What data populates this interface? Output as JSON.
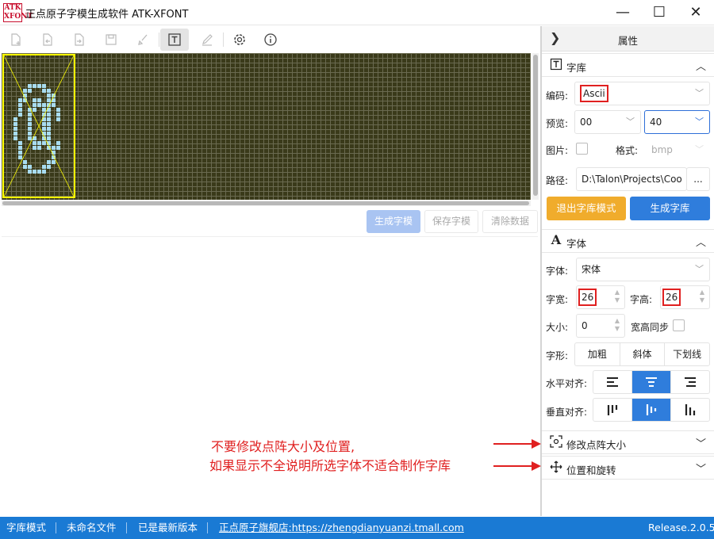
{
  "window": {
    "title": "正点原子字模生成软件 ATK-XFONT",
    "logo_text": "ATK XFONT",
    "minimize": "—",
    "maximize": "☐",
    "close": "✕"
  },
  "toolbar": {
    "icons": [
      "new-file-icon",
      "open-file-icon",
      "import-icon",
      "save-icon",
      "brush-icon",
      "text-icon",
      "pen-icon",
      "gear-icon",
      "info-icon"
    ],
    "active": "text-icon"
  },
  "actions": {
    "generate": "生成字模",
    "save": "保存字模",
    "clear": "清除数据"
  },
  "panel": {
    "title": "属性",
    "library_section": {
      "title": "字库",
      "encoding_label": "编码:",
      "encoding_value": "Ascii",
      "preview_label": "预览:",
      "preview_from": "00",
      "preview_to": "40",
      "image_label": "图片:",
      "format_label": "格式:",
      "format_value": "bmp",
      "path_label": "路径:",
      "path_value": "D:\\Talon\\Projects\\Coo",
      "browse": "...",
      "exit_button": "退出字库模式",
      "generate_button": "生成字库"
    },
    "font_section": {
      "title": "字体",
      "font_label": "字体:",
      "font_value": "宋体",
      "width_label": "字宽:",
      "width_value": "26",
      "height_label": "字高:",
      "height_value": "26",
      "size_label": "大小:",
      "size_value": "0",
      "sync_label": "宽高同步",
      "shape_label": "字形:",
      "bold": "加粗",
      "italic": "斜体",
      "underline": "下划线",
      "halign_label": "水平对齐:",
      "valign_label": "垂直对齐:"
    },
    "resize_section": {
      "title": "修改点阵大小"
    },
    "transform_section": {
      "title": "位置和旋转"
    }
  },
  "annotation": {
    "line1": "不要修改点阵大小及位置,",
    "line2": "如果显示不全说明所选字体不适合制作字库"
  },
  "status": {
    "mode": "字库模式",
    "file": "未命名文件",
    "version_status": "已是最新版本",
    "shop_label": "正点原子旗舰店:",
    "shop_url": "https://zhengdianyuanzi.tmall.com",
    "release": "Release.2.0.5"
  },
  "colors": {
    "accent": "#2f7ddc",
    "warning": "#f0ac2c",
    "status": "#1a7ad4",
    "glyph": "#a8dcf0",
    "canvas": "#3a3a1a",
    "annotation": "#e02020"
  }
}
